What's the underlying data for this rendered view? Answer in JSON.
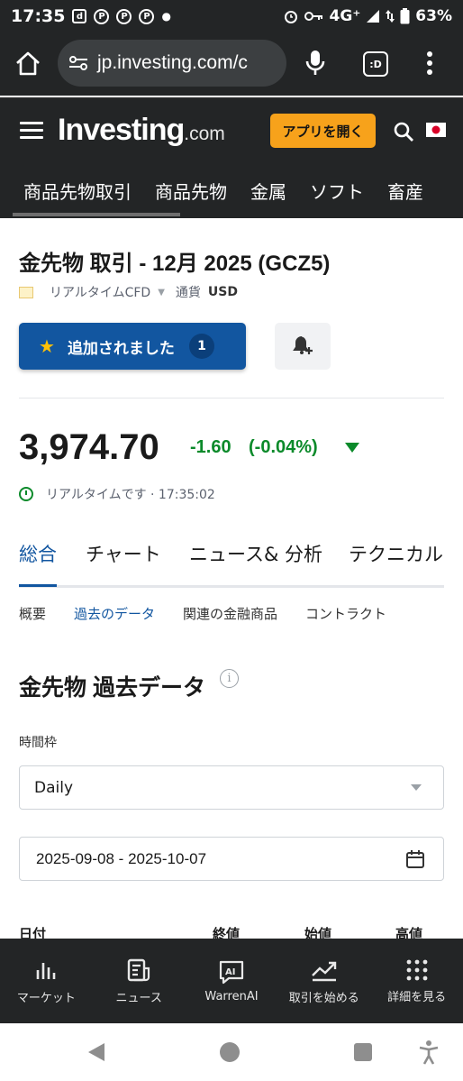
{
  "status_bar": {
    "time": "17:35",
    "network": "4G⁺",
    "battery": "63%"
  },
  "browser": {
    "url": "jp.investing.com/c",
    "tab_label": ":D"
  },
  "site": {
    "logo_main": "Investing",
    "logo_suffix": ".com",
    "app_button": "アプリを開く"
  },
  "categories": [
    "商品先物取引",
    "商品先物",
    "金属",
    "ソフト",
    "畜産"
  ],
  "instrument": {
    "title": "金先物 取引 - 12月 2025 (GCZ5)",
    "source": "リアルタイムCFD",
    "currency_label": "通貨",
    "currency": "USD"
  },
  "watchlist": {
    "added_label": "追加されました",
    "count": "1"
  },
  "quote": {
    "price": "3,974.70",
    "change": "-1.60",
    "change_pct": "(-0.04%)",
    "realtime_label": "リアルタイムです · 17:35:02"
  },
  "tabs": [
    "総合",
    "チャート",
    "ニュース& 分析",
    "テクニカル"
  ],
  "subtabs": [
    "概要",
    "過去のデータ",
    "関連の金融商品",
    "コントラクト"
  ],
  "historical": {
    "title": "金先物 過去データ",
    "timeframe_label": "時間枠",
    "timeframe_value": "Daily",
    "date_range": "2025-09-08 - 2025-10-07",
    "columns": [
      "日付",
      "終値",
      "始値",
      "高値"
    ]
  },
  "bottom_nav": [
    "マーケット",
    "ニュース",
    "WarrenAI",
    "取引を始める",
    "詳細を見る"
  ],
  "colors": {
    "accent_blue": "#1256a0",
    "brand_orange": "#f7a21b",
    "positive_green": "#0b8a2a",
    "dark_bg": "#232526"
  }
}
